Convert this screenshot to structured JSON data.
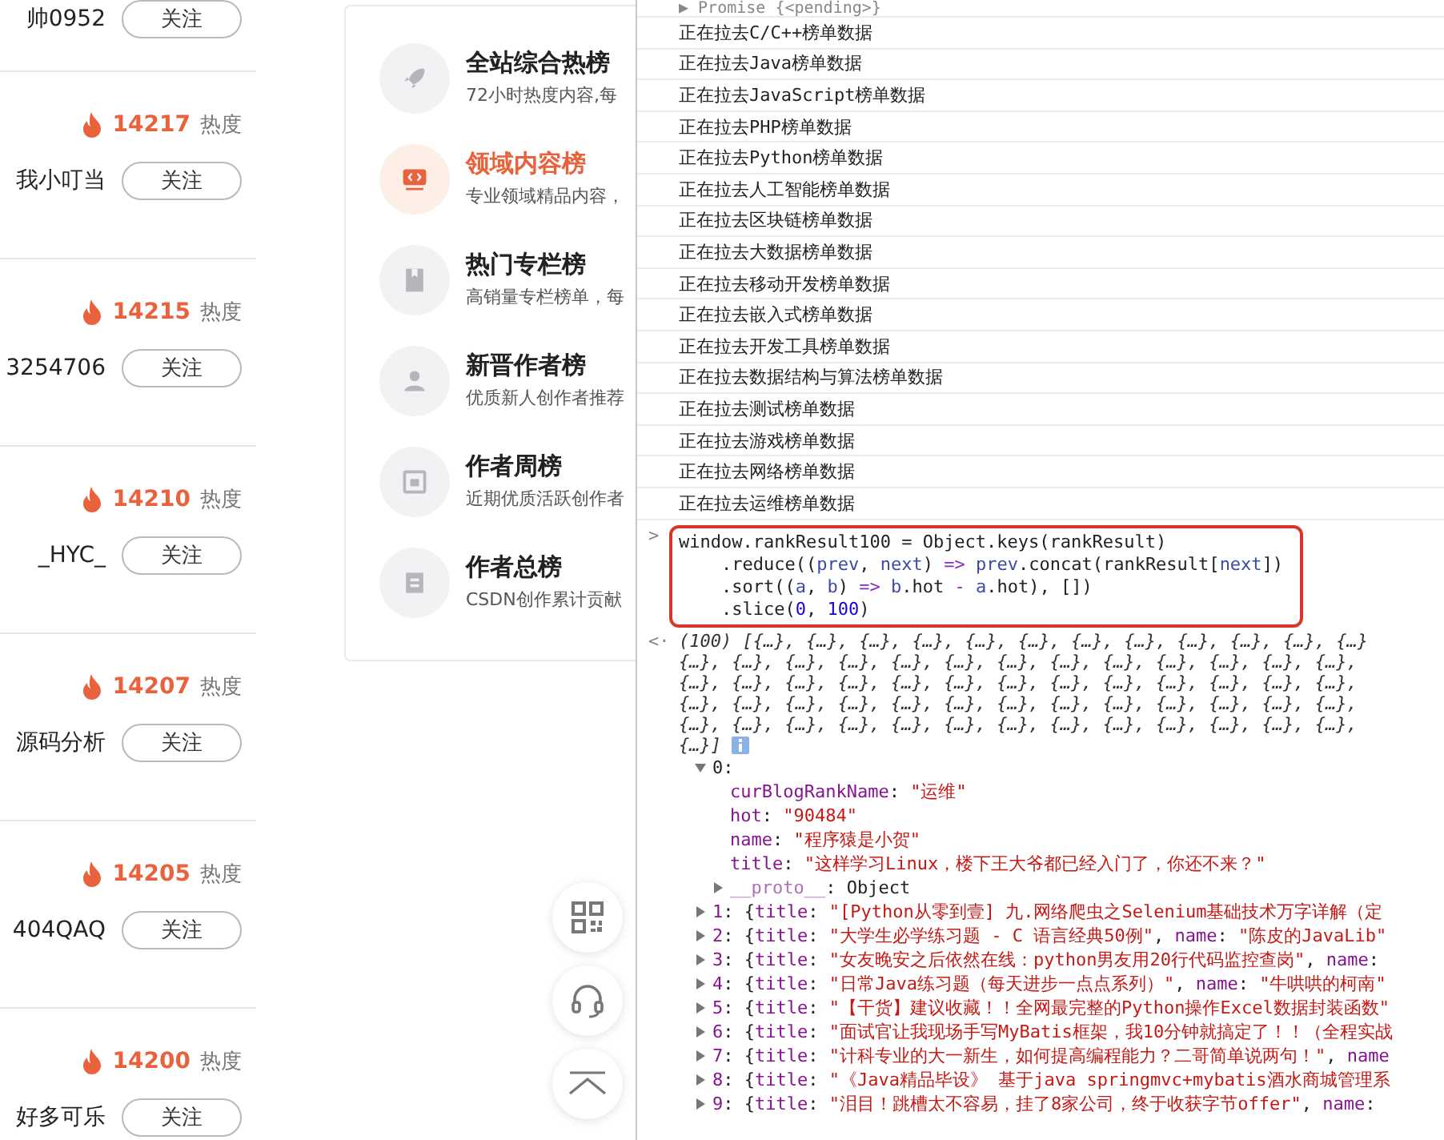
{
  "rank_list": {
    "rows": [
      {
        "name": "帅0952",
        "follow": "关注"
      },
      {
        "heat": "14217",
        "heat_label": "热度",
        "name": "我小叮当",
        "follow": "关注"
      },
      {
        "heat": "14215",
        "heat_label": "热度",
        "name": "3254706",
        "follow": "关注"
      },
      {
        "heat": "14210",
        "heat_label": "热度",
        "name": "_HYC_",
        "follow": "关注"
      },
      {
        "heat": "14207",
        "heat_label": "热度",
        "name": "源码分析",
        "follow": "关注"
      },
      {
        "heat": "14205",
        "heat_label": "热度",
        "name": "404QAQ",
        "follow": "关注"
      },
      {
        "heat": "14200",
        "heat_label": "热度",
        "name": "好多可乐",
        "follow": "关注"
      }
    ]
  },
  "rank_menu": {
    "items": [
      {
        "title": "全站综合热榜",
        "desc": "72小时热度内容,每",
        "selected": false
      },
      {
        "title": "领域内容榜",
        "desc": "专业领域精品内容，",
        "selected": true
      },
      {
        "title": "热门专栏榜",
        "desc": "高销量专栏榜单，每",
        "selected": false
      },
      {
        "title": "新晋作者榜",
        "desc": "优质新人创作者推荐",
        "selected": false
      },
      {
        "title": "作者周榜",
        "desc": "近期优质活跃创作者",
        "selected": false
      },
      {
        "title": "作者总榜",
        "desc": "CSDN创作累计贡献",
        "selected": false
      }
    ]
  },
  "console": {
    "first_line": "▶ Promise {<pending>}",
    "logs": [
      "正在拉去C/C++榜单数据",
      "正在拉去Java榜单数据",
      "正在拉去JavaScript榜单数据",
      "正在拉去PHP榜单数据",
      "正在拉去Python榜单数据",
      "正在拉去人工智能榜单数据",
      "正在拉去区块链榜单数据",
      "正在拉去大数据榜单数据",
      "正在拉去移动开发榜单数据",
      "正在拉去嵌入式榜单数据",
      "正在拉去开发工具榜单数据",
      "正在拉去数据结构与算法榜单数据",
      "正在拉去测试榜单数据",
      "正在拉去游戏榜单数据",
      "正在拉去网络榜单数据",
      "正在拉去运维榜单数据"
    ],
    "input_prompt": ">",
    "input_code": [
      [
        {
          "kind": "plain",
          "text": "window.rankResult100 = Object.keys(rankResult)"
        }
      ],
      [
        {
          "kind": "plain",
          "text": "    .reduce(("
        },
        {
          "kind": "param",
          "text": "prev"
        },
        {
          "kind": "plain",
          "text": ", "
        },
        {
          "kind": "param",
          "text": "next"
        },
        {
          "kind": "plain",
          "text": ") "
        },
        {
          "kind": "keyword",
          "text": "=>"
        },
        {
          "kind": "param",
          "text": " prev"
        },
        {
          "kind": "plain",
          "text": ".concat(rankResult["
        },
        {
          "kind": "param",
          "text": "next"
        },
        {
          "kind": "plain",
          "text": "])"
        }
      ],
      [
        {
          "kind": "plain",
          "text": "    .sort(("
        },
        {
          "kind": "param",
          "text": "a"
        },
        {
          "kind": "plain",
          "text": ", "
        },
        {
          "kind": "param",
          "text": "b"
        },
        {
          "kind": "plain",
          "text": ") "
        },
        {
          "kind": "keyword",
          "text": "=>"
        },
        {
          "kind": "param",
          "text": " b"
        },
        {
          "kind": "plain",
          "text": ".hot "
        },
        {
          "kind": "keyword",
          "text": "-"
        },
        {
          "kind": "param",
          "text": " a"
        },
        {
          "kind": "plain",
          "text": ".hot), [])"
        }
      ],
      [
        {
          "kind": "plain",
          "text": "    .slice("
        },
        {
          "kind": "number",
          "text": "0"
        },
        {
          "kind": "plain",
          "text": ", "
        },
        {
          "kind": "number",
          "text": "100"
        },
        {
          "kind": "plain",
          "text": ")"
        }
      ]
    ],
    "result_prompt": "<·",
    "result_summary": [
      "(100) [{…}, {…}, {…}, {…}, {…}, {…}, {…}, {…}, {…}, {…}, {…}, {…}",
      "{…}, {…}, {…}, {…}, {…}, {…}, {…}, {…}, {…}, {…}, {…}, {…}, {…},",
      "{…}, {…}, {…}, {…}, {…}, {…}, {…}, {…}, {…}, {…}, {…}, {…}, {…},",
      "{…}, {…}, {…}, {…}, {…}, {…}, {…}, {…}, {…}, {…}, {…}, {…}, {…},",
      "{…}, {…}, {…}, {…}, {…}, {…}, {…}, {…}, {…}, {…}, {…}, {…}, {…},",
      "{…}]"
    ],
    "tree": [
      {
        "kind": "entry",
        "expanded": true,
        "tokens": [
          {
            "kind": "plain",
            "text": "0:"
          }
        ]
      },
      {
        "kind": "prop",
        "tokens": [
          {
            "kind": "key",
            "text": "curBlogRankName"
          },
          {
            "kind": "plain",
            "text": ": "
          },
          {
            "kind": "string",
            "text": "\"运维\""
          }
        ]
      },
      {
        "kind": "prop",
        "tokens": [
          {
            "kind": "key",
            "text": "hot"
          },
          {
            "kind": "plain",
            "text": ": "
          },
          {
            "kind": "string",
            "text": "\"90484\""
          }
        ]
      },
      {
        "kind": "prop",
        "tokens": [
          {
            "kind": "key",
            "text": "name"
          },
          {
            "kind": "plain",
            "text": ": "
          },
          {
            "kind": "string",
            "text": "\"程序猿是小贺\""
          }
        ]
      },
      {
        "kind": "prop",
        "tokens": [
          {
            "kind": "key",
            "text": "title"
          },
          {
            "kind": "plain",
            "text": ": "
          },
          {
            "kind": "string",
            "text": "\"这样学习Linux，楼下王大爷都已经入门了，你还不来？\""
          }
        ]
      },
      {
        "kind": "proto",
        "expanded": false,
        "tokens": [
          {
            "kind": "dimkey",
            "text": "__proto__"
          },
          {
            "kind": "plain",
            "text": ": Object"
          }
        ]
      },
      {
        "kind": "entry",
        "expanded": false,
        "tokens": [
          {
            "kind": "key",
            "text": "1"
          },
          {
            "kind": "plain",
            "text": ": {"
          },
          {
            "kind": "key",
            "text": "title"
          },
          {
            "kind": "plain",
            "text": ": "
          },
          {
            "kind": "string",
            "text": "\"[Python从零到壹] 九.网络爬虫之Selenium基础技术万字详解（定"
          }
        ]
      },
      {
        "kind": "entry",
        "expanded": false,
        "tokens": [
          {
            "kind": "key",
            "text": "2"
          },
          {
            "kind": "plain",
            "text": ": {"
          },
          {
            "kind": "key",
            "text": "title"
          },
          {
            "kind": "plain",
            "text": ": "
          },
          {
            "kind": "string",
            "text": "\"大学生必学练习题 - C 语言经典50例\""
          },
          {
            "kind": "plain",
            "text": ", "
          },
          {
            "kind": "key",
            "text": "name"
          },
          {
            "kind": "plain",
            "text": ": "
          },
          {
            "kind": "string",
            "text": "\"陈皮的JavaLib\""
          }
        ]
      },
      {
        "kind": "entry",
        "expanded": false,
        "tokens": [
          {
            "kind": "key",
            "text": "3"
          },
          {
            "kind": "plain",
            "text": ": {"
          },
          {
            "kind": "key",
            "text": "title"
          },
          {
            "kind": "plain",
            "text": ": "
          },
          {
            "kind": "string",
            "text": "\"女友晚安之后依然在线：python男友用20行代码监控查岗\""
          },
          {
            "kind": "plain",
            "text": ", "
          },
          {
            "kind": "key",
            "text": "name"
          },
          {
            "kind": "plain",
            "text": ":"
          }
        ]
      },
      {
        "kind": "entry",
        "expanded": false,
        "tokens": [
          {
            "kind": "key",
            "text": "4"
          },
          {
            "kind": "plain",
            "text": ": {"
          },
          {
            "kind": "key",
            "text": "title"
          },
          {
            "kind": "plain",
            "text": ": "
          },
          {
            "kind": "string",
            "text": "\"日常Java练习题（每天进步一点点系列）\""
          },
          {
            "kind": "plain",
            "text": ", "
          },
          {
            "kind": "key",
            "text": "name"
          },
          {
            "kind": "plain",
            "text": ": "
          },
          {
            "kind": "string",
            "text": "\"牛哄哄的柯南\""
          }
        ]
      },
      {
        "kind": "entry",
        "expanded": false,
        "tokens": [
          {
            "kind": "key",
            "text": "5"
          },
          {
            "kind": "plain",
            "text": ": {"
          },
          {
            "kind": "key",
            "text": "title"
          },
          {
            "kind": "plain",
            "text": ": "
          },
          {
            "kind": "string",
            "text": "\"【干货】建议收藏！！全网最完整的Python操作Excel数据封装函数\""
          }
        ]
      },
      {
        "kind": "entry",
        "expanded": false,
        "tokens": [
          {
            "kind": "key",
            "text": "6"
          },
          {
            "kind": "plain",
            "text": ": {"
          },
          {
            "kind": "key",
            "text": "title"
          },
          {
            "kind": "plain",
            "text": ": "
          },
          {
            "kind": "string",
            "text": "\"面试官让我现场手写MyBatis框架，我10分钟就搞定了！！（全程实战"
          }
        ]
      },
      {
        "kind": "entry",
        "expanded": false,
        "tokens": [
          {
            "kind": "key",
            "text": "7"
          },
          {
            "kind": "plain",
            "text": ": {"
          },
          {
            "kind": "key",
            "text": "title"
          },
          {
            "kind": "plain",
            "text": ": "
          },
          {
            "kind": "string",
            "text": "\"计科专业的大一新生，如何提高编程能力？二哥简单说两句！\""
          },
          {
            "kind": "plain",
            "text": ", "
          },
          {
            "kind": "key",
            "text": "name"
          }
        ]
      },
      {
        "kind": "entry",
        "expanded": false,
        "tokens": [
          {
            "kind": "key",
            "text": "8"
          },
          {
            "kind": "plain",
            "text": ": {"
          },
          {
            "kind": "key",
            "text": "title"
          },
          {
            "kind": "plain",
            "text": ": "
          },
          {
            "kind": "string",
            "text": "\"《Java精品毕设》 基于java springmvc+mybatis酒水商城管理系"
          }
        ]
      },
      {
        "kind": "entry",
        "expanded": false,
        "tokens": [
          {
            "kind": "key",
            "text": "9"
          },
          {
            "kind": "plain",
            "text": ": {"
          },
          {
            "kind": "key",
            "text": "title"
          },
          {
            "kind": "plain",
            "text": ": "
          },
          {
            "kind": "string",
            "text": "\"泪目！跳槽太不容易，挂了8家公司，终于收获字节offer\""
          },
          {
            "kind": "plain",
            "text": ", "
          },
          {
            "kind": "key",
            "text": "name"
          },
          {
            "kind": "plain",
            "text": ":"
          }
        ]
      }
    ]
  }
}
